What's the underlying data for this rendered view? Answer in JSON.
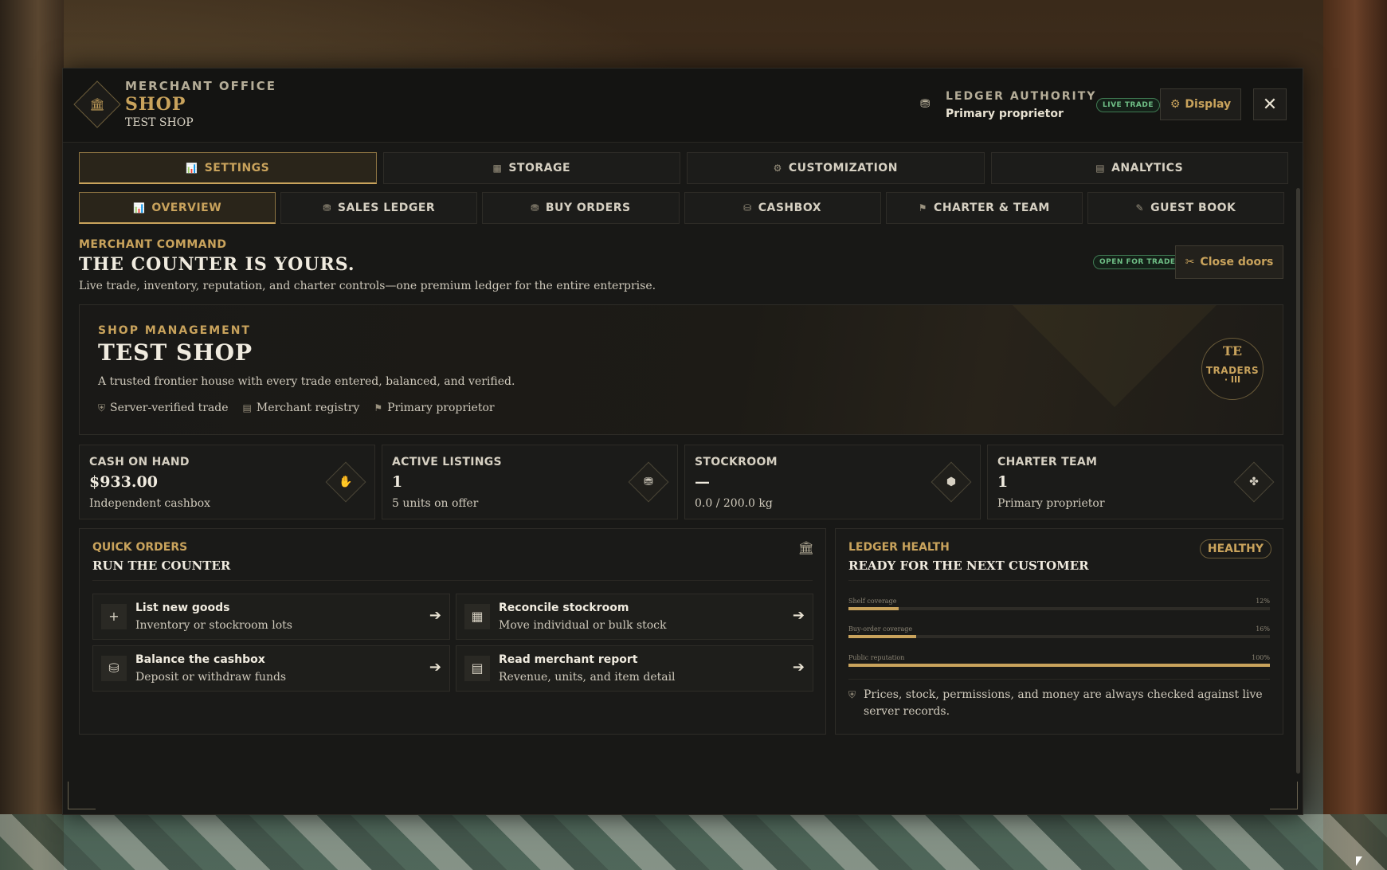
{
  "header": {
    "kicker": "MERCHANT OFFICE",
    "title": "SHOP",
    "subtitle": "TEST SHOP",
    "logo_icon": "🏛",
    "authority_icon": "⛃",
    "authority_kicker": "LEDGER AUTHORITY",
    "authority_value": "Primary proprietor",
    "live_badge": "LIVE TRADE",
    "display_icon": "⚙",
    "display_label": "Display",
    "close_icon": "✕"
  },
  "main_tabs": [
    {
      "label": "SETTINGS",
      "icon": "📊",
      "active": true
    },
    {
      "label": "STORAGE",
      "icon": "▦",
      "active": false
    },
    {
      "label": "CUSTOMIZATION",
      "icon": "⚙",
      "active": false
    },
    {
      "label": "ANALYTICS",
      "icon": "▤",
      "active": false
    }
  ],
  "sub_tabs": [
    {
      "label": "OVERVIEW",
      "icon": "📊",
      "active": true
    },
    {
      "label": "SALES LEDGER",
      "icon": "⛃",
      "active": false
    },
    {
      "label": "BUY ORDERS",
      "icon": "⛃",
      "active": false
    },
    {
      "label": "CASHBOX",
      "icon": "⛁",
      "active": false
    },
    {
      "label": "CHARTER & TEAM",
      "icon": "⚑",
      "active": false
    },
    {
      "label": "GUEST BOOK",
      "icon": "✎",
      "active": false
    }
  ],
  "intro": {
    "kicker": "MERCHANT COMMAND",
    "title": "THE COUNTER IS YOURS.",
    "description": "Live trade, inventory, reputation, and charter controls—one premium ledger for the entire enterprise.",
    "status_badge": "OPEN FOR TRADE",
    "doors_icon": "✂",
    "doors_label": "Close doors"
  },
  "hero": {
    "kicker": "SHOP MANAGEMENT",
    "title": "TEST SHOP",
    "description": "A trusted frontier house with every trade entered, balanced, and verified.",
    "tags": [
      {
        "icon": "⛨",
        "label": "Server-verified trade"
      },
      {
        "icon": "▤",
        "label": "Merchant registry"
      },
      {
        "icon": "⚑",
        "label": "Primary proprietor"
      }
    ],
    "seal": {
      "line1": "TE",
      "line2": "TRADERS",
      "line3": "· III"
    }
  },
  "stats": [
    {
      "label": "CASH ON HAND",
      "value": "$933.00",
      "sub": "Independent cashbox",
      "icon": "✋"
    },
    {
      "label": "ACTIVE LISTINGS",
      "value": "1",
      "sub": "5 units on offer",
      "icon": "⛃"
    },
    {
      "label": "STOCKROOM",
      "value": "—",
      "sub": "0.0 / 200.0 kg",
      "icon": "⬢"
    },
    {
      "label": "CHARTER TEAM",
      "value": "1",
      "sub": "Primary proprietor",
      "icon": "✤"
    }
  ],
  "quick_orders": {
    "kicker": "QUICK ORDERS",
    "title": "RUN THE COUNTER",
    "icon": "🏛",
    "actions": [
      {
        "title": "List new goods",
        "sub": "Inventory or stockroom lots",
        "icon": "+",
        "arrow": "➔"
      },
      {
        "title": "Reconcile stockroom",
        "sub": "Move individual or bulk stock",
        "icon": "▦",
        "arrow": "➔"
      },
      {
        "title": "Balance the cashbox",
        "sub": "Deposit or withdraw funds",
        "icon": "⛁",
        "arrow": "➔"
      },
      {
        "title": "Read merchant report",
        "sub": "Revenue, units, and item detail",
        "icon": "▤",
        "arrow": "➔"
      }
    ]
  },
  "ledger_health": {
    "kicker": "LEDGER HEALTH",
    "title": "READY FOR THE NEXT CUSTOMER",
    "badge": "HEALTHY",
    "bars": [
      {
        "label": "Shelf coverage",
        "percent_label": "12%",
        "value": 12
      },
      {
        "label": "Buy-order coverage",
        "percent_label": "16%",
        "value": 16
      },
      {
        "label": "Public reputation",
        "percent_label": "100%",
        "value": 100
      }
    ],
    "note_icon": "⛨",
    "note": "Prices, stock, permissions, and money are always checked against live server records."
  }
}
